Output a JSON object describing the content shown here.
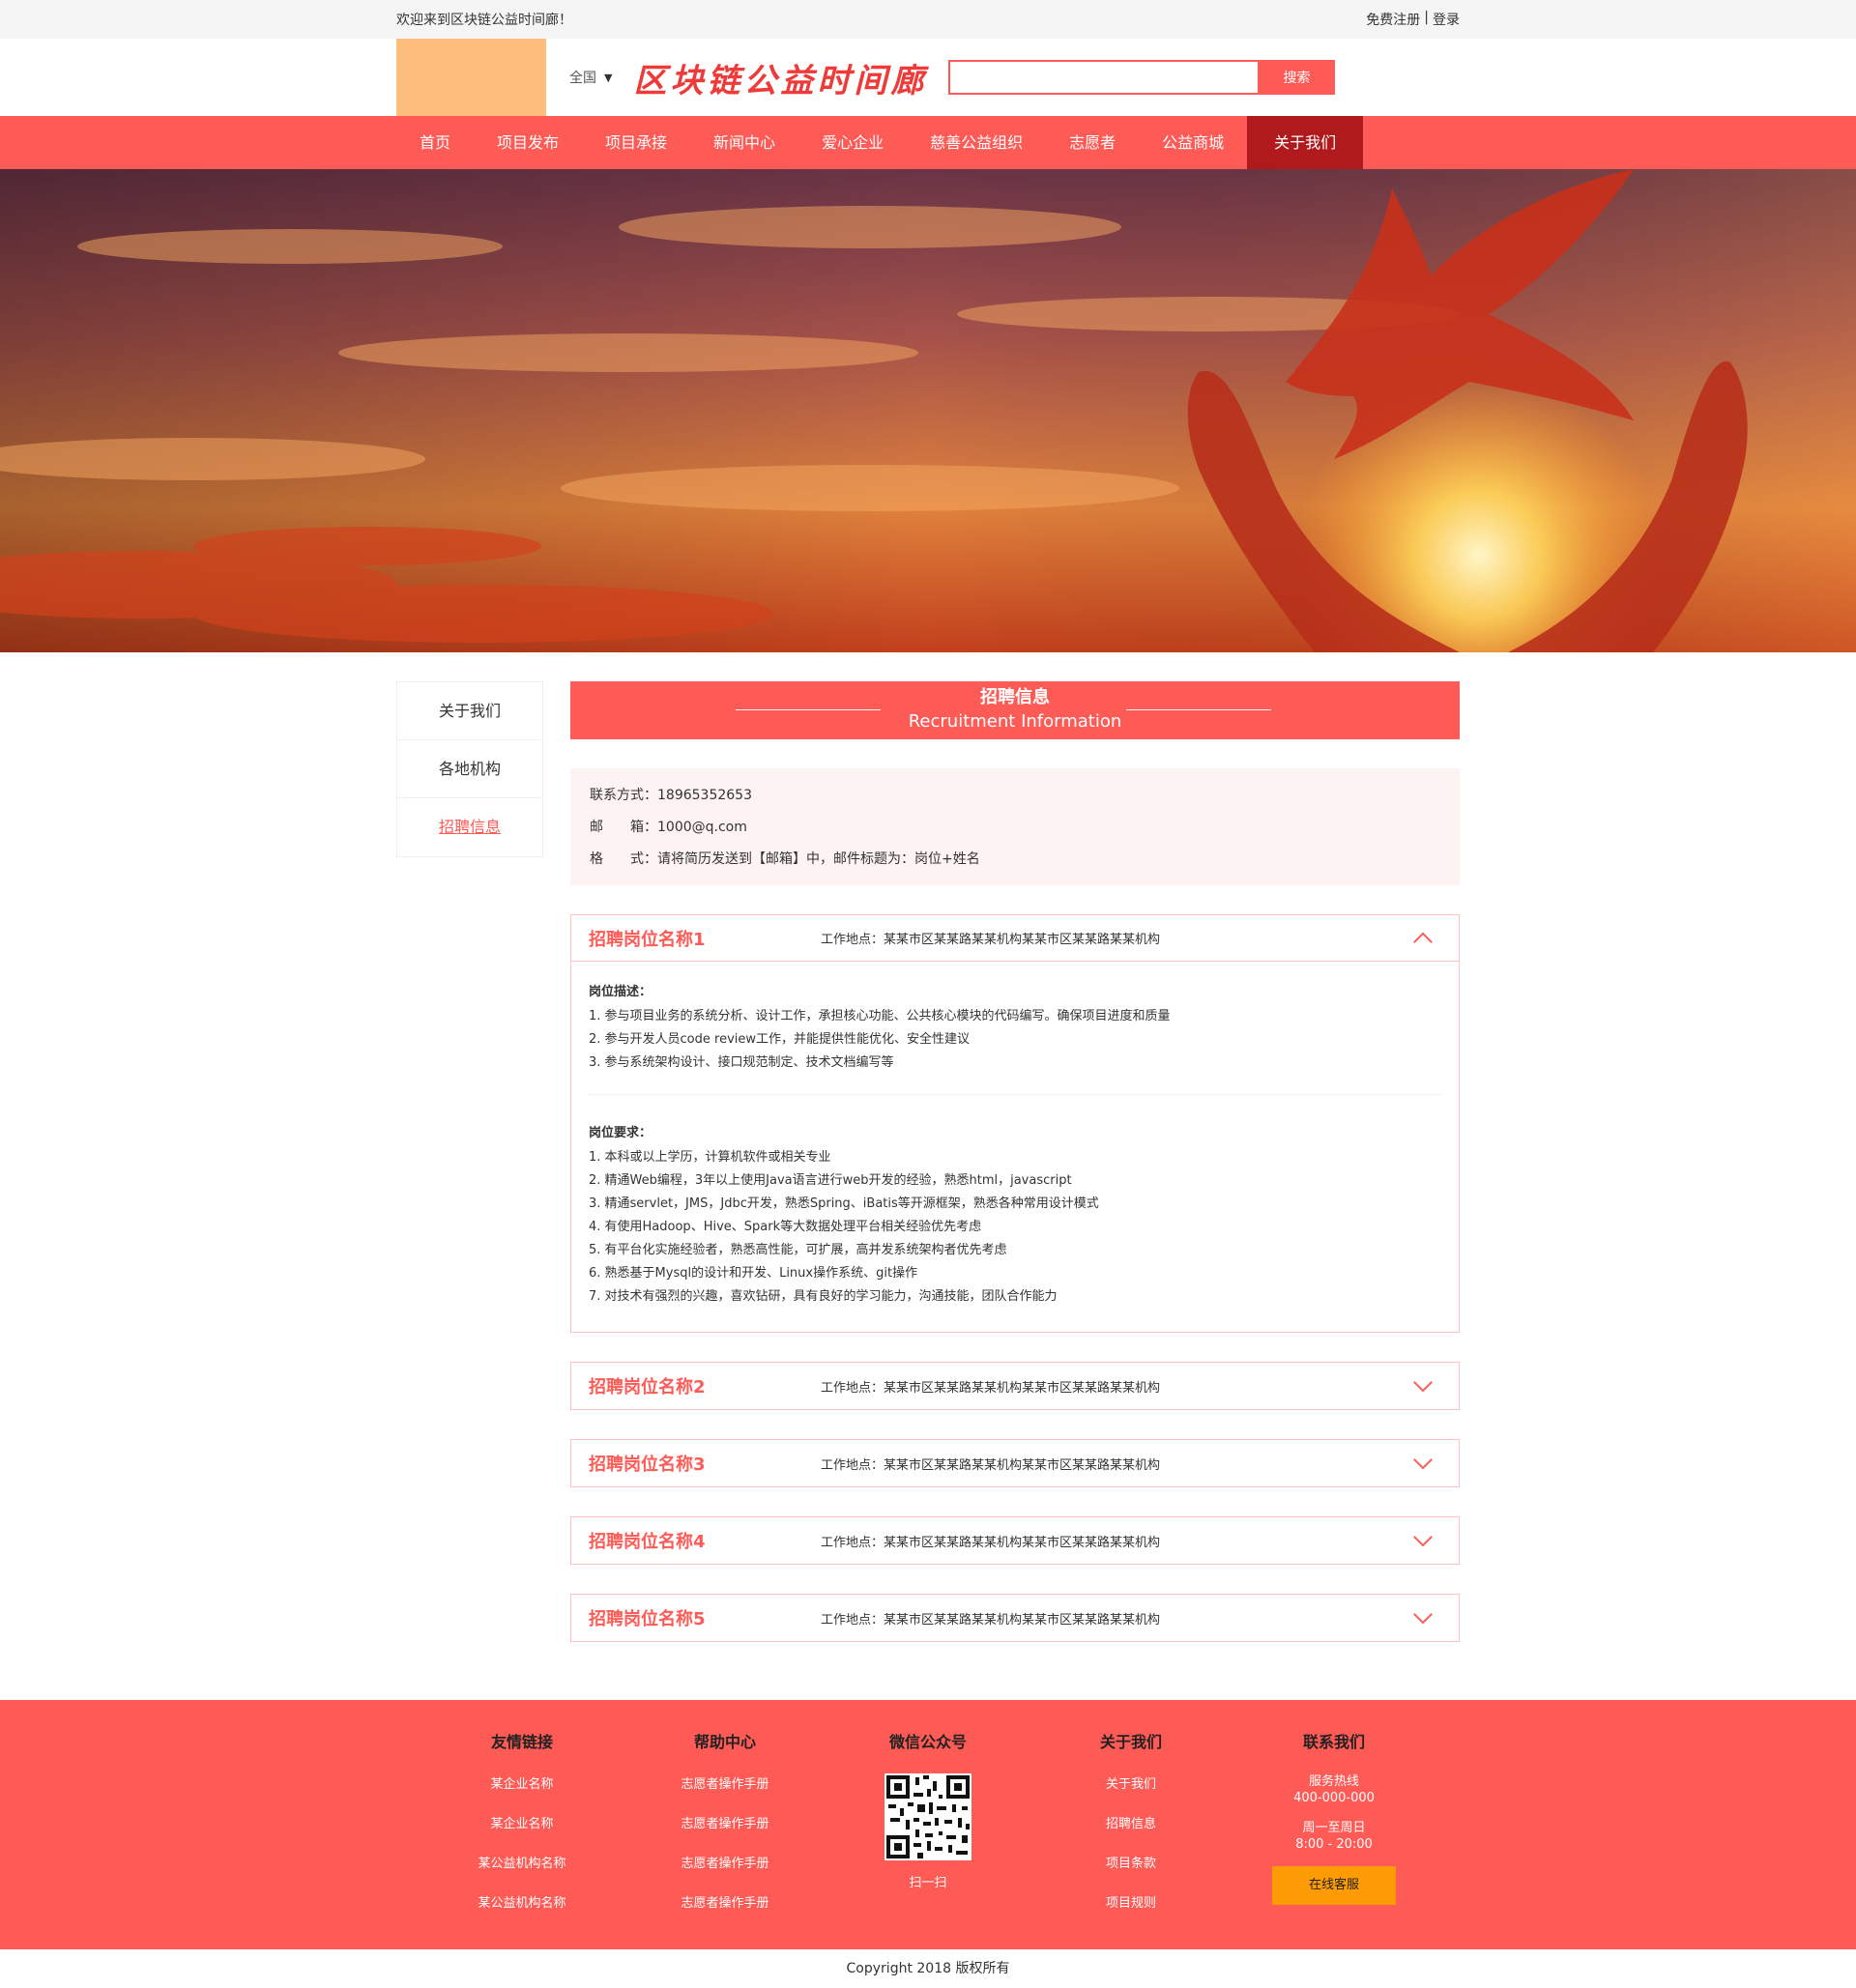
{
  "topbar": {
    "welcome": "欢迎来到区块链公益时间廊！",
    "register": "免费注册",
    "divider": "|",
    "login": "登录"
  },
  "header": {
    "region": "全国",
    "brand": "区块链公益时间廊",
    "search_placeholder": "",
    "search_button": "搜索"
  },
  "nav": {
    "items": [
      "首页",
      "项目发布",
      "项目承接",
      "新闻中心",
      "爱心企业",
      "慈善公益组织",
      "志愿者",
      "公益商城",
      "关于我们"
    ],
    "active_index": 8
  },
  "sidebar": {
    "items": [
      "关于我们",
      "各地机构",
      "招聘信息"
    ],
    "active_index": 2
  },
  "section": {
    "title_cn": "招聘信息",
    "title_en": "Recruitment Information"
  },
  "contact": {
    "phone_label": "联系方式：",
    "phone": "18965352653",
    "email_label": "邮　　箱：",
    "email": "1000@q.com",
    "format_label": "格　　式：",
    "format": "请将简历发送到【邮箱】中，邮件标题为：岗位+姓名"
  },
  "jobs": [
    {
      "name": "招聘岗位名称1",
      "location": "工作地点：某某市区某某路某某机构某某市区某某路某某机构",
      "open": true,
      "desc_title": "岗位描述：",
      "desc": [
        "1.  参与项目业务的系统分析、设计工作，承担核心功能、公共核心模块的代码编写。确保项目进度和质量",
        "2.  参与开发人员code review工作，并能提供性能优化、安全性建议",
        "3.  参与系统架构设计、接口规范制定、技术文档编写等"
      ],
      "req_title": "岗位要求：",
      "req": [
        "1.  本科或以上学历，计算机软件或相关专业",
        "2.  精通Web编程，3年以上使用Java语言进行web开发的经验，熟悉html，javascript",
        "3.  精通servlet，JMS，Jdbc开发，熟悉Spring、iBatis等开源框架，熟悉各种常用设计模式",
        "4.  有使用Hadoop、Hive、Spark等大数据处理平台相关经验优先考虑",
        "5.  有平台化实施经验者，熟悉高性能，可扩展，高并发系统架构者优先考虑",
        "6.  熟悉基于Mysql的设计和开发、Linux操作系统、git操作",
        "7.  对技术有强烈的兴趣，喜欢钻研，具有良好的学习能力，沟通技能，团队合作能力"
      ]
    },
    {
      "name": "招聘岗位名称2",
      "location": "工作地点：某某市区某某路某某机构某某市区某某路某某机构",
      "open": false
    },
    {
      "name": "招聘岗位名称3",
      "location": "工作地点：某某市区某某路某某机构某某市区某某路某某机构",
      "open": false
    },
    {
      "name": "招聘岗位名称4",
      "location": "工作地点：某某市区某某路某某机构某某市区某某路某某机构",
      "open": false
    },
    {
      "name": "招聘岗位名称5",
      "location": "工作地点：某某市区某某路某某机构某某市区某某路某某机构",
      "open": false
    }
  ],
  "footer": {
    "links": {
      "title": "友情链接",
      "items": [
        "某企业名称",
        "某企业名称",
        "某公益机构名称",
        "某公益机构名称"
      ]
    },
    "help": {
      "title": "帮助中心",
      "items": [
        "志愿者操作手册",
        "志愿者操作手册",
        "志愿者操作手册",
        "志愿者操作手册"
      ]
    },
    "wechat": {
      "title": "微信公众号",
      "scan": "扫一扫"
    },
    "about": {
      "title": "关于我们",
      "items": [
        "关于我们",
        "招聘信息",
        "项目条款",
        "项目规则"
      ]
    },
    "contact": {
      "title": "联系我们",
      "hotline_label": "服务热线",
      "hotline": "400-000-000",
      "hours_label": "周一至周日",
      "hours": "8:00 - 20:00",
      "service_button": "在线客服"
    },
    "copyright": "Copyright 2018 版权所有"
  },
  "colors": {
    "primary": "#fe5a56",
    "nav_active": "#b01a1d",
    "logo_placeholder": "#fdbd7b",
    "service_button": "#fd9b05"
  }
}
